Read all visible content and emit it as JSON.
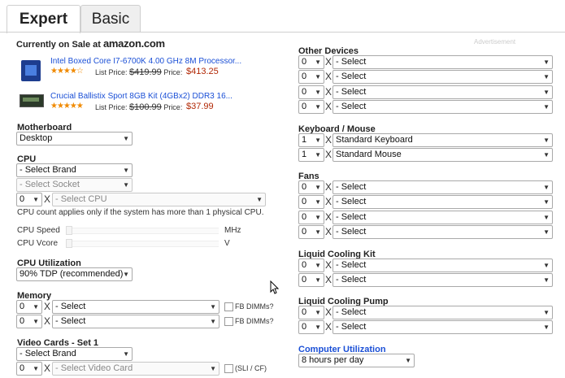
{
  "tabs": {
    "expert": "Expert",
    "basic": "Basic"
  },
  "sale": {
    "heading": "Currently on Sale at",
    "brand": "amazon.com",
    "ad_label": "Advertisement"
  },
  "products": [
    {
      "title": "Intel Boxed Core I7-6700K 4.00 GHz 8M Processor...",
      "stars": "★★★★☆",
      "list_label": "List Price:",
      "list_price": "$419.99",
      "price_label": "Price:",
      "price": "$413.25"
    },
    {
      "title": "Crucial Ballistix Sport 8GB Kit (4GBx2) DDR3 16...",
      "stars": "★★★★★",
      "list_label": "List Price:",
      "list_price": "$100.99",
      "price_label": "Price:",
      "price": "$37.99"
    }
  ],
  "motherboard": {
    "label": "Motherboard",
    "value": "Desktop"
  },
  "cpu": {
    "label": "CPU",
    "brand": "- Select Brand",
    "socket": "- Select Socket",
    "count": "0",
    "x": "X",
    "cpu": "- Select CPU",
    "note": "CPU count applies only if the system has more than 1 physical CPU."
  },
  "cpu_speed": {
    "label": "CPU Speed",
    "unit": "MHz"
  },
  "cpu_vcore": {
    "label": "CPU Vcore",
    "unit": "V"
  },
  "cpu_util": {
    "label": "CPU Utilization",
    "value": "90% TDP (recommended)"
  },
  "memory": {
    "label": "Memory",
    "rows": [
      {
        "count": "0",
        "value": "- Select",
        "fb": "FB DIMMs?"
      },
      {
        "count": "0",
        "value": "- Select",
        "fb": "FB DIMMs?"
      }
    ]
  },
  "video": {
    "label": "Video Cards - Set 1",
    "brand": "- Select Brand",
    "count": "0",
    "card": "- Select Video Card",
    "sli": "(SLI / CF)"
  },
  "other_devices": {
    "label": "Other Devices",
    "rows": [
      {
        "count": "0",
        "value": "- Select"
      },
      {
        "count": "0",
        "value": "- Select"
      },
      {
        "count": "0",
        "value": "- Select"
      },
      {
        "count": "0",
        "value": "- Select"
      }
    ]
  },
  "keyboard_mouse": {
    "label": "Keyboard / Mouse",
    "rows": [
      {
        "count": "1",
        "value": "Standard Keyboard"
      },
      {
        "count": "1",
        "value": "Standard Mouse"
      }
    ]
  },
  "fans": {
    "label": "Fans",
    "rows": [
      {
        "count": "0",
        "value": "- Select"
      },
      {
        "count": "0",
        "value": "- Select"
      },
      {
        "count": "0",
        "value": "- Select"
      },
      {
        "count": "0",
        "value": "- Select"
      }
    ]
  },
  "liquid_kit": {
    "label": "Liquid Cooling Kit",
    "rows": [
      {
        "count": "0",
        "value": "- Select"
      },
      {
        "count": "0",
        "value": "- Select"
      }
    ]
  },
  "liquid_pump": {
    "label": "Liquid Cooling Pump",
    "rows": [
      {
        "count": "0",
        "value": "- Select"
      },
      {
        "count": "0",
        "value": "- Select"
      }
    ]
  },
  "computer_util": {
    "label": "Computer Utilization",
    "value": "8 hours per day"
  },
  "x_sep": "X",
  "colors": {
    "link": "#1a4fd6",
    "price": "#b12704",
    "star": "#f08a00"
  }
}
